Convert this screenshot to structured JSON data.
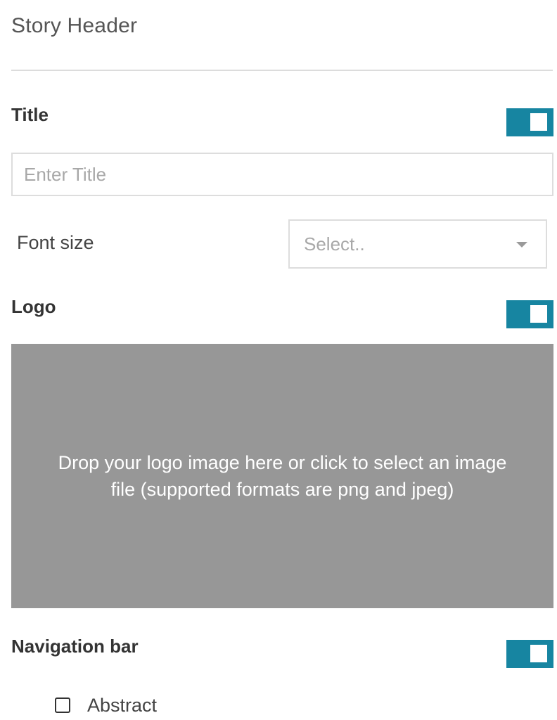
{
  "panel": {
    "title": "Story Header"
  },
  "title_section": {
    "label": "Title",
    "toggle_on": true,
    "input_placeholder": "Enter Title",
    "input_value": ""
  },
  "font_size": {
    "label": "Font size",
    "select_placeholder": "Select.."
  },
  "logo_section": {
    "label": "Logo",
    "toggle_on": true,
    "dropzone_line1": "Drop your logo image here or click to select an image",
    "dropzone_line2": "file (supported formats are png and jpeg)"
  },
  "navigation_section": {
    "label": "Navigation bar",
    "toggle_on": true,
    "options": [
      {
        "label": "Abstract",
        "checked": false
      }
    ]
  },
  "colors": {
    "toggle_accent": "#1785a1",
    "dropzone_bg": "#979797"
  }
}
